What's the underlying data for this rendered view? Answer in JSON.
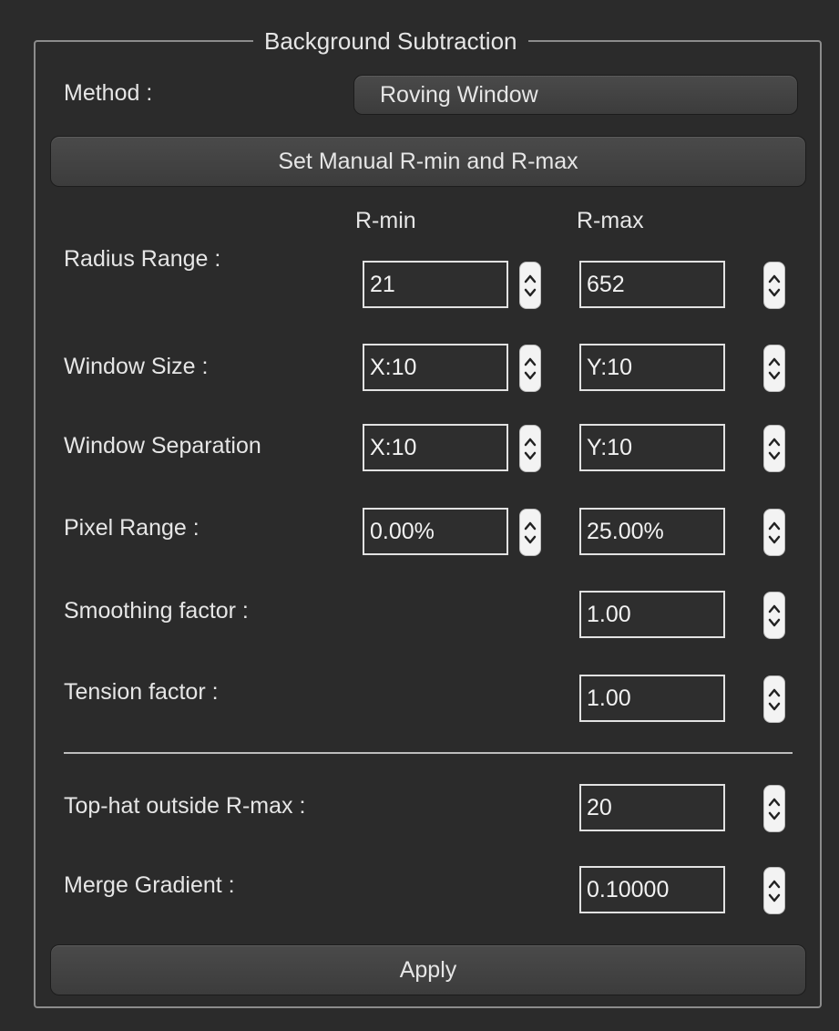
{
  "group_title": "Background Subtraction",
  "method": {
    "label": "Method :",
    "value": "Roving Window"
  },
  "manual_button": "Set Manual R-min and R-max",
  "headers": {
    "rmin": "R-min",
    "rmax": "R-max"
  },
  "rows": {
    "radius_range": {
      "label": "Radius Range :",
      "min": "21",
      "max": "652"
    },
    "window_size": {
      "label": "Window Size :",
      "x": "X:10",
      "y": "Y:10"
    },
    "window_separation": {
      "label": "Window Separation",
      "x": "X:10",
      "y": "Y:10"
    },
    "pixel_range": {
      "label": "Pixel Range :",
      "min": "0.00%",
      "max": "25.00%"
    },
    "smoothing_factor": {
      "label": "Smoothing factor :",
      "value": "1.00"
    },
    "tension_factor": {
      "label": "Tension factor :",
      "value": "1.00"
    },
    "tophat": {
      "label": "Top-hat outside R-max :",
      "value": "20"
    },
    "merge_gradient": {
      "label": "Merge Gradient :",
      "value": "0.10000"
    }
  },
  "apply_button": "Apply",
  "icons": {
    "spin_arrows": "up-down-chevron-icon"
  }
}
